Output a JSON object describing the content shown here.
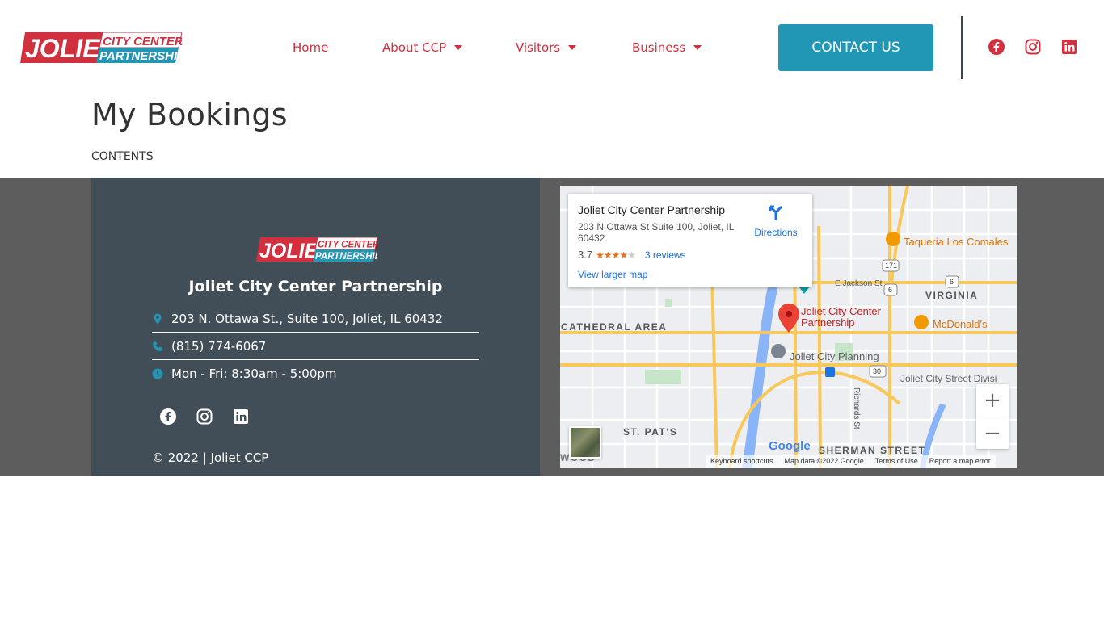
{
  "header": {
    "logo": {
      "line1": "JOLIET",
      "line2a": "CITY CENTER",
      "line2b": "PARTNERSHIP"
    },
    "nav": [
      {
        "label": "Home",
        "has_caret": false
      },
      {
        "label": "About CCP",
        "has_caret": true
      },
      {
        "label": "Visitors",
        "has_caret": true
      },
      {
        "label": "Business",
        "has_caret": true
      }
    ],
    "contact_label": "CONTACT US",
    "social_icons": [
      "facebook-icon",
      "instagram-icon",
      "linkedin-icon"
    ]
  },
  "page": {
    "title": "My Bookings",
    "contents_label": "CONTENTS"
  },
  "footer": {
    "org_name": "Joliet City Center Partnership",
    "address": "203 N. Ottawa St., Suite 100, Joliet, IL 60432",
    "phone": "(815) 774-6067",
    "hours": "Mon - Fri: 8:30am - 5:00pm",
    "copyright": "© 2022 | Joliet CCP"
  },
  "map": {
    "card": {
      "title": "Joliet City Center Partnership",
      "address": "203 N Ottawa St Suite 100, Joliet, IL 60432",
      "rating": "3.7",
      "reviews": "3 reviews",
      "larger_map": "View larger map",
      "directions": "Directions"
    },
    "labels": {
      "taqueria": "Taqueria Los Comales",
      "jackson": "E Jackson St",
      "virginia": "VIRGINIA",
      "cathedral": "CATHEDRAL AREA",
      "pin_label_1": "Joliet City Center",
      "pin_label_2": "Partnership",
      "mcdonalds": "McDonald's",
      "planning": "Joliet City Planning",
      "street_div": "Joliet City Street Divisi",
      "st_pats": "ST. PAT'S",
      "richards": "Richards St",
      "sherman": "SHERMAN STREET",
      "wood": "WOOD",
      "google": "Google",
      "route_171": "171",
      "route_6a": "6",
      "route_6b": "6",
      "route_30": "30"
    },
    "attribution": {
      "shortcuts": "Keyboard shortcuts",
      "data": "Map data ©2022 Google",
      "terms": "Terms of Use",
      "report": "Report a map error"
    },
    "zoom_in": "+",
    "zoom_out": "−"
  },
  "colors": {
    "brand_red": "#d2303f",
    "brand_blue": "#2196b5",
    "footer_panel": "#424e57",
    "footer_bg": "#5d5d5d"
  }
}
